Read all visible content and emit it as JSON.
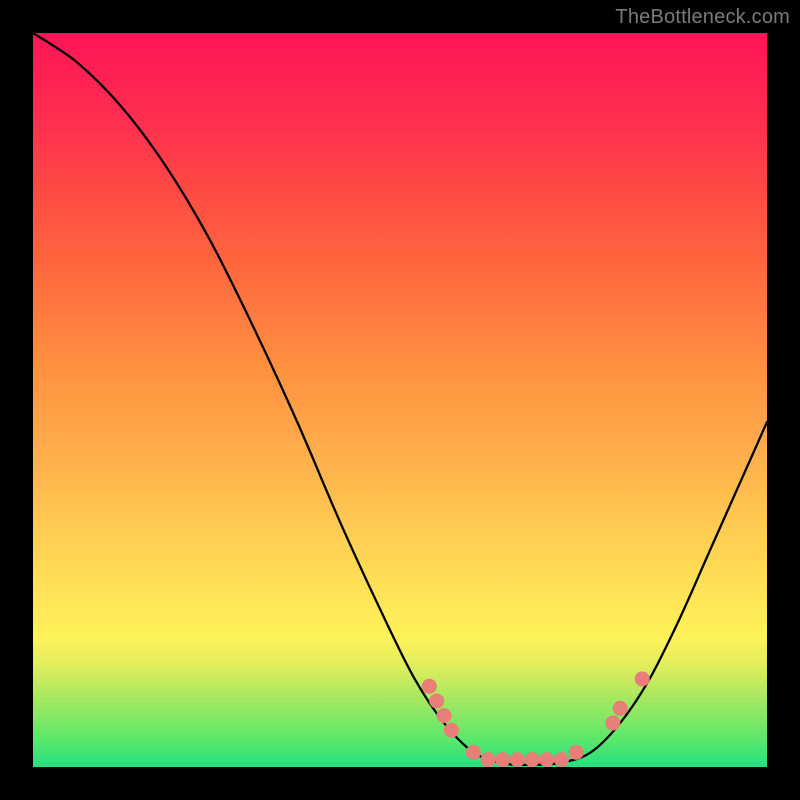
{
  "watermark": "TheBottleneck.com",
  "chart_data": {
    "type": "line",
    "title": "",
    "xlabel": "",
    "ylabel": "",
    "xlim": [
      0,
      100
    ],
    "ylim": [
      0,
      100
    ],
    "curve": [
      {
        "x": 0,
        "y": 100
      },
      {
        "x": 6,
        "y": 96
      },
      {
        "x": 12,
        "y": 90
      },
      {
        "x": 18,
        "y": 82
      },
      {
        "x": 24,
        "y": 72
      },
      {
        "x": 30,
        "y": 60
      },
      {
        "x": 36,
        "y": 47
      },
      {
        "x": 42,
        "y": 33
      },
      {
        "x": 48,
        "y": 20
      },
      {
        "x": 52,
        "y": 12
      },
      {
        "x": 56,
        "y": 6
      },
      {
        "x": 60,
        "y": 2
      },
      {
        "x": 64,
        "y": 0.5
      },
      {
        "x": 68,
        "y": 0.3
      },
      {
        "x": 72,
        "y": 0.6
      },
      {
        "x": 76,
        "y": 2
      },
      {
        "x": 80,
        "y": 6
      },
      {
        "x": 84,
        "y": 12
      },
      {
        "x": 88,
        "y": 20
      },
      {
        "x": 92,
        "y": 29
      },
      {
        "x": 96,
        "y": 38
      },
      {
        "x": 100,
        "y": 47
      }
    ],
    "points": [
      {
        "x": 54,
        "y": 11
      },
      {
        "x": 55,
        "y": 9
      },
      {
        "x": 56,
        "y": 7
      },
      {
        "x": 57,
        "y": 5
      },
      {
        "x": 60,
        "y": 2
      },
      {
        "x": 62,
        "y": 1
      },
      {
        "x": 64,
        "y": 1
      },
      {
        "x": 66,
        "y": 1
      },
      {
        "x": 68,
        "y": 1
      },
      {
        "x": 70,
        "y": 1
      },
      {
        "x": 72,
        "y": 1
      },
      {
        "x": 74,
        "y": 2
      },
      {
        "x": 79,
        "y": 6
      },
      {
        "x": 80,
        "y": 8
      },
      {
        "x": 83,
        "y": 12
      }
    ],
    "colors": {
      "curve": "#000000",
      "points": "#e77e77",
      "gradient_top": "#ff1657",
      "gradient_mid": "#fff259",
      "gradient_bottom": "#25e07f"
    }
  }
}
